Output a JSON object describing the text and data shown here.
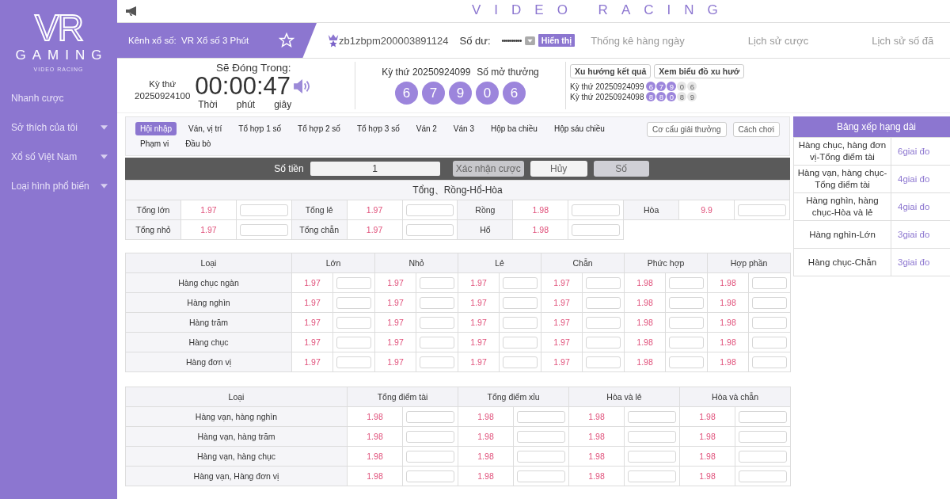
{
  "sidebar": {
    "logo": "VR",
    "brand": "GAMING",
    "tagline": "VIDEO RACING",
    "items": [
      {
        "label": "Nhanh cược",
        "kind": "link"
      },
      {
        "label": "Sở thích của tôi",
        "kind": "group",
        "expanded": false
      },
      {
        "label": "Xổ số Việt Nam",
        "kind": "group",
        "expanded": false
      },
      {
        "label": "Loại hình phổ biến",
        "kind": "group",
        "expanded": false
      }
    ]
  },
  "header": {
    "title": "VIDEO RACING",
    "channel_label": "Kênh xổ số:",
    "channel": "VR Xổ số 3 Phút",
    "favorite": false,
    "username": "zb1zbpm200003891124",
    "balance_label": "Số dư:",
    "balance": "••••••••••",
    "show_button": "Hiển thị",
    "nav": [
      "Thống kê hàng ngày",
      "Lịch sử cược",
      "Lịch sử số đã"
    ]
  },
  "draw": {
    "period_label": "Kỳ thứ",
    "period": "20250924100",
    "closing_label": "Sẽ Đóng Trong:",
    "countdown": "00:00:47",
    "units": [
      "Thời",
      "phút",
      "giây"
    ],
    "sound_on": true
  },
  "result": {
    "period_label": "Kỳ thứ 20250924099",
    "numbers_label": "Số mở thưởng",
    "balls": [
      "6",
      "7",
      "9",
      "0",
      "6"
    ]
  },
  "trend": {
    "buttons": [
      "Xu hướng kết quả",
      "Xem biểu đồ xu hướ"
    ],
    "rows": [
      {
        "label": "Kỳ thứ 20250924099",
        "balls": [
          {
            "n": "6",
            "highlighted": true
          },
          {
            "n": "7",
            "highlighted": true
          },
          {
            "n": "9",
            "highlighted": true
          },
          {
            "n": "0",
            "highlighted": false
          },
          {
            "n": "6",
            "highlighted": false
          }
        ]
      },
      {
        "label": "Kỳ thứ 20250924098",
        "balls": [
          {
            "n": "8",
            "highlighted": true
          },
          {
            "n": "8",
            "highlighted": true
          },
          {
            "n": "0",
            "highlighted": true
          },
          {
            "n": "8",
            "highlighted": false
          },
          {
            "n": "9",
            "highlighted": false
          }
        ]
      }
    ]
  },
  "bet_tabs": [
    {
      "label": "Hội nhập",
      "selected": true
    },
    {
      "label": "Ván, vị trí",
      "selected": false
    },
    {
      "label": "Tổ hợp 1 số",
      "selected": false
    },
    {
      "label": "Tổ hợp 2 số",
      "selected": false
    },
    {
      "label": "Tổ hợp 3 số",
      "selected": false
    },
    {
      "label": "Ván 2",
      "selected": false
    },
    {
      "label": "Ván 3",
      "selected": false
    },
    {
      "label": "Hộp ba chiều",
      "selected": false
    },
    {
      "label": "Hộp sáu chiều",
      "selected": false
    },
    {
      "label": "Phạm vi",
      "selected": false
    },
    {
      "label": "Đầu bò",
      "selected": false
    }
  ],
  "side_buttons": [
    "Cơ cấu giải thưởng",
    "Cách chơi"
  ],
  "bet_bar": {
    "amount_label": "Số tiền",
    "amount": "1",
    "confirm": "Xác nhận cược",
    "cancel": "Hủy",
    "number": "Số"
  },
  "sum_table": {
    "title": "Tổng、Rồng-Hổ-Hòa",
    "rows": [
      [
        {
          "label": "Tổng lớn",
          "odds": "1.97"
        },
        {
          "label": "Tổng lẻ",
          "odds": "1.97"
        },
        {
          "label": "Rồng",
          "odds": "1.98"
        },
        {
          "label": "Hòa",
          "odds": "9.9"
        }
      ],
      [
        {
          "label": "Tổng nhỏ",
          "odds": "1.97"
        },
        {
          "label": "Tổng chẵn",
          "odds": "1.97"
        },
        {
          "label": "Hổ",
          "odds": "1.98"
        }
      ]
    ]
  },
  "digit_table": {
    "columns": [
      "Loại",
      "Lớn",
      "Nhỏ",
      "Lẻ",
      "Chẵn",
      "Phức hợp",
      "Hợp phần"
    ],
    "rows": [
      {
        "label": "Hàng chục ngàn",
        "odds": [
          "1.97",
          "1.97",
          "1.97",
          "1.97",
          "1.98",
          "1.98"
        ]
      },
      {
        "label": "Hàng nghìn",
        "odds": [
          "1.97",
          "1.97",
          "1.97",
          "1.97",
          "1.98",
          "1.98"
        ]
      },
      {
        "label": "Hàng trăm",
        "odds": [
          "1.97",
          "1.97",
          "1.97",
          "1.97",
          "1.98",
          "1.98"
        ]
      },
      {
        "label": "Hàng chục",
        "odds": [
          "1.97",
          "1.97",
          "1.97",
          "1.97",
          "1.98",
          "1.98"
        ]
      },
      {
        "label": "Hàng đơn vị",
        "odds": [
          "1.97",
          "1.97",
          "1.97",
          "1.97",
          "1.98",
          "1.98"
        ]
      }
    ]
  },
  "pair_table": {
    "columns": [
      "Loại",
      "Tổng điểm tài",
      "Tổng điểm xỉu",
      "Hòa và lẻ",
      "Hòa và chẵn"
    ],
    "rows": [
      {
        "label": "Hàng vạn, hàng nghìn",
        "odds": [
          "1.98",
          "1.98",
          "1.98",
          "1.98"
        ]
      },
      {
        "label": "Hàng vạn, hàng trăm",
        "odds": [
          "1.98",
          "1.98",
          "1.98",
          "1.98"
        ]
      },
      {
        "label": "Hàng vạn, hàng chục",
        "odds": [
          "1.98",
          "1.98",
          "1.98",
          "1.98"
        ]
      },
      {
        "label": "Hàng vạn, Hàng đơn vị",
        "odds": [
          "1.98",
          "1.98",
          "1.98",
          "1.98"
        ]
      }
    ]
  },
  "ranking": {
    "title": "Bảng xếp hạng dài",
    "rows": [
      {
        "name": "Hàng chục, hàng đơn vị-Tổng điểm tài",
        "value": "6giai đo"
      },
      {
        "name": "Hàng vạn, hàng chục-Tổng điểm tài",
        "value": "4giai đo"
      },
      {
        "name": "Hàng nghìn, hàng chục-Hòa và lẻ",
        "value": "4giai đo"
      },
      {
        "name": "Hàng nghìn-Lớn",
        "value": "3giai đo"
      },
      {
        "name": "Hàng chục-Chẵn",
        "value": "3giai đo"
      }
    ]
  }
}
